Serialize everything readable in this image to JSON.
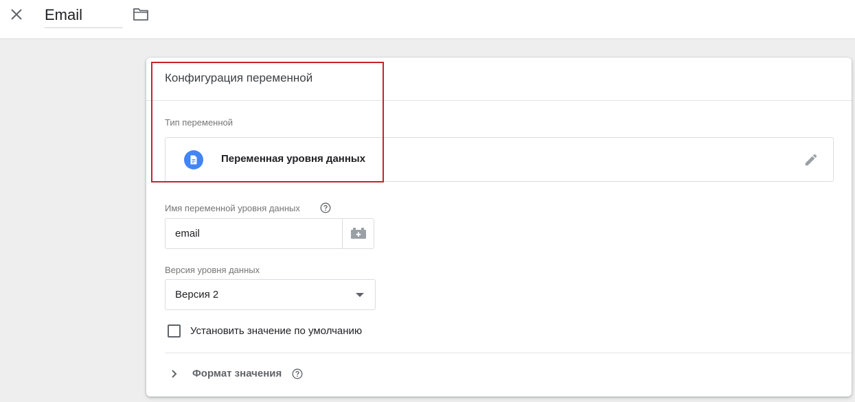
{
  "header": {
    "title": "Email",
    "close_icon": "close-icon",
    "folder_icon": "folder-icon"
  },
  "card": {
    "title": "Конфигурация переменной",
    "type_label": "Тип переменной",
    "type_name": "Переменная уровня данных",
    "type_icon": "document-icon",
    "type_icon_color": "#4285f4",
    "highlight_color": "#c8202a",
    "datalayer": {
      "label": "Имя переменной уровня данных",
      "value": "email"
    },
    "version": {
      "label": "Версия уровня данных",
      "selected": "Версия 2"
    },
    "default_checkbox": {
      "label": "Установить значение по умолчанию",
      "checked": false
    },
    "format": {
      "label": "Формат значения"
    }
  }
}
